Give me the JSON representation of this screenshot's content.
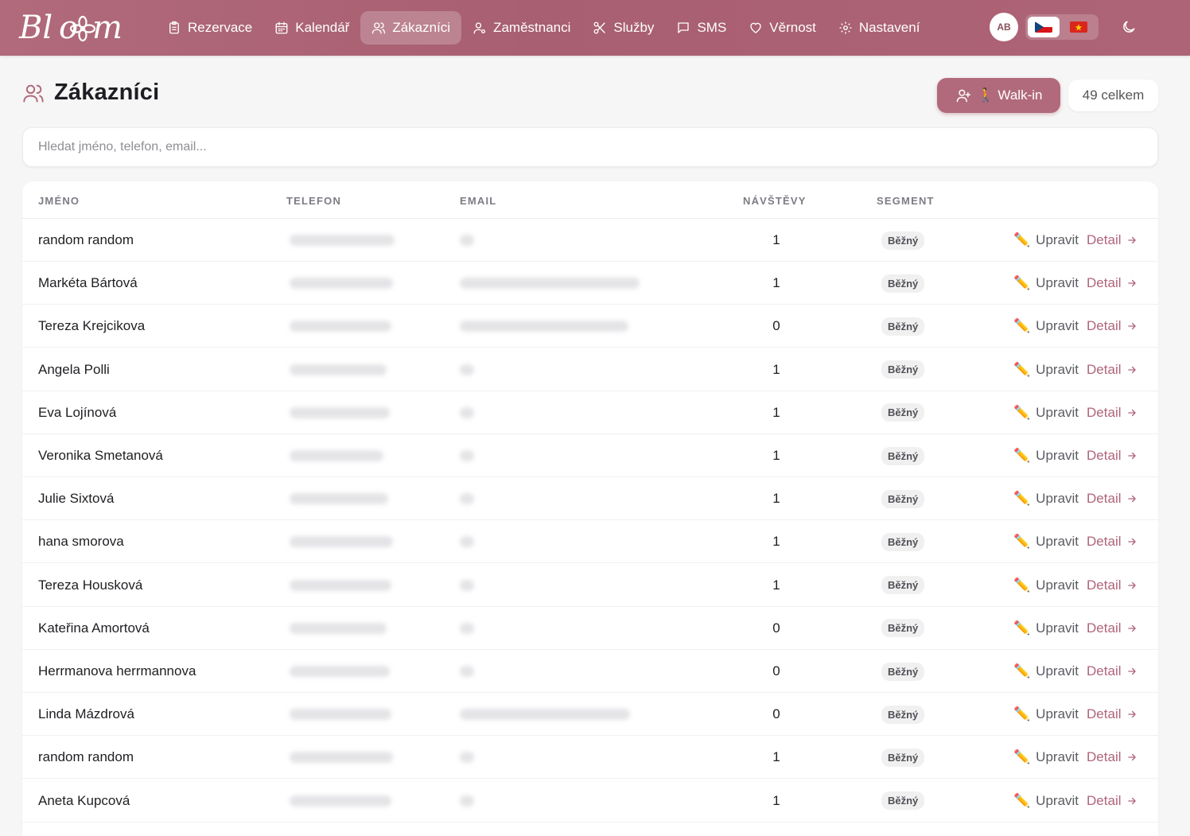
{
  "brand": {
    "name": "Blossom",
    "logo_text": "Blossom"
  },
  "nav": {
    "items": [
      {
        "label": "Rezervace",
        "icon": "clipboard-icon",
        "active": false
      },
      {
        "label": "Kalendář",
        "icon": "calendar-icon",
        "active": false
      },
      {
        "label": "Zákazníci",
        "icon": "users-icon",
        "active": true
      },
      {
        "label": "Zaměstnanci",
        "icon": "user-cog-icon",
        "active": false
      },
      {
        "label": "Služby",
        "icon": "scissors-icon",
        "active": false
      },
      {
        "label": "SMS",
        "icon": "message-icon",
        "active": false
      },
      {
        "label": "Věrnost",
        "icon": "heart-icon",
        "active": false
      },
      {
        "label": "Nastavení",
        "icon": "gear-icon",
        "active": false
      }
    ],
    "avatar_initials": "AB",
    "languages": [
      {
        "code": "cs",
        "icon": "czech-flag-icon",
        "active": true
      },
      {
        "code": "vi",
        "icon": "vietnam-flag-icon",
        "active": false
      }
    ],
    "theme_icon": "moon-icon"
  },
  "header": {
    "title": "Zákazníci",
    "walkin_label": "🚶 Walk-in",
    "total_label": "49 celkem"
  },
  "search": {
    "placeholder": "Hledat jméno, telefon, email...",
    "value": ""
  },
  "table": {
    "columns": [
      "JMÉNO",
      "TELEFON",
      "EMAIL",
      "NÁVŠTĚVY",
      "SEGMENT"
    ],
    "edit_label": "Upravit",
    "detail_label": "Detail",
    "rows": [
      {
        "name": "random random",
        "visits": "1",
        "segment": "Běžný",
        "has_email": false
      },
      {
        "name": "Markéta Bártová",
        "visits": "1",
        "segment": "Běžný",
        "has_email": true
      },
      {
        "name": "Tereza Krejcikova",
        "visits": "0",
        "segment": "Běžný",
        "has_email": true
      },
      {
        "name": "Angela Polli",
        "visits": "1",
        "segment": "Běžný",
        "has_email": false
      },
      {
        "name": "Eva Lojínová",
        "visits": "1",
        "segment": "Běžný",
        "has_email": false
      },
      {
        "name": "Veronika Smetanová",
        "visits": "1",
        "segment": "Běžný",
        "has_email": false
      },
      {
        "name": "Julie Sixtová",
        "visits": "1",
        "segment": "Běžný",
        "has_email": false
      },
      {
        "name": "hana smorova",
        "visits": "1",
        "segment": "Běžný",
        "has_email": false
      },
      {
        "name": "Tereza Housková",
        "visits": "1",
        "segment": "Běžný",
        "has_email": false
      },
      {
        "name": "Kateřina Amortová",
        "visits": "0",
        "segment": "Běžný",
        "has_email": false
      },
      {
        "name": "Herrmanova herrmannova",
        "visits": "0",
        "segment": "Běžný",
        "has_email": false
      },
      {
        "name": "Linda Mázdrová",
        "visits": "0",
        "segment": "Běžný",
        "has_email": true
      },
      {
        "name": "random random",
        "visits": "1",
        "segment": "Běžný",
        "has_email": false
      },
      {
        "name": "Aneta Kupcová",
        "visits": "1",
        "segment": "Běžný",
        "has_email": false
      }
    ]
  },
  "colors": {
    "accent": "#b06a7b",
    "nav_bg": "#a85f71",
    "detail_link": "#b0647a"
  }
}
